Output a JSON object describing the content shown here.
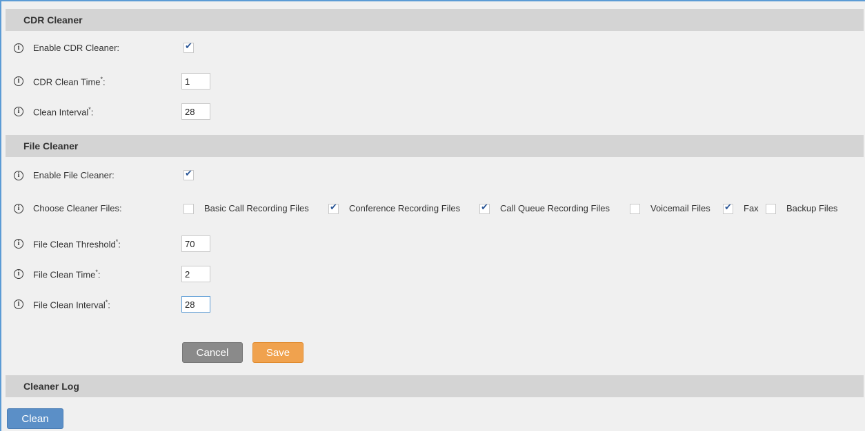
{
  "cdr_cleaner": {
    "title": "CDR Cleaner",
    "enable_label": "Enable CDR Cleaner:",
    "enable_checked": true,
    "clean_time_label": "CDR Clean Time",
    "clean_time_value": "1",
    "clean_interval_label": "Clean Interval",
    "clean_interval_value": "28"
  },
  "file_cleaner": {
    "title": "File Cleaner",
    "enable_label": "Enable File Cleaner:",
    "enable_checked": true,
    "choose_label": "Choose Cleaner Files:",
    "files": [
      {
        "label": "Basic Call Recording Files",
        "checked": false
      },
      {
        "label": "Conference Recording Files",
        "checked": true
      },
      {
        "label": "Call Queue Recording Files",
        "checked": true
      },
      {
        "label": "Voicemail Files",
        "checked": false
      },
      {
        "label": "Fax",
        "checked": true
      },
      {
        "label": "Backup Files",
        "checked": false
      }
    ],
    "threshold_label": "File Clean Threshold",
    "threshold_value": "70",
    "clean_time_label": "File Clean Time",
    "clean_time_value": "2",
    "clean_interval_label": "File Clean Interval",
    "clean_interval_value": "28"
  },
  "required_mark": "*",
  "colon": ":",
  "info_glyph": "i",
  "buttons": {
    "cancel": "Cancel",
    "save": "Save",
    "clean": "Clean"
  },
  "cleaner_log": {
    "title": "Cleaner Log"
  },
  "check_glyph": "✔",
  "colors": {
    "accent": "#5b9bd5",
    "save": "#f0a24e",
    "cancel": "#8a8a8a",
    "clean": "#5b8fc7",
    "header_bg": "#d4d4d4"
  }
}
